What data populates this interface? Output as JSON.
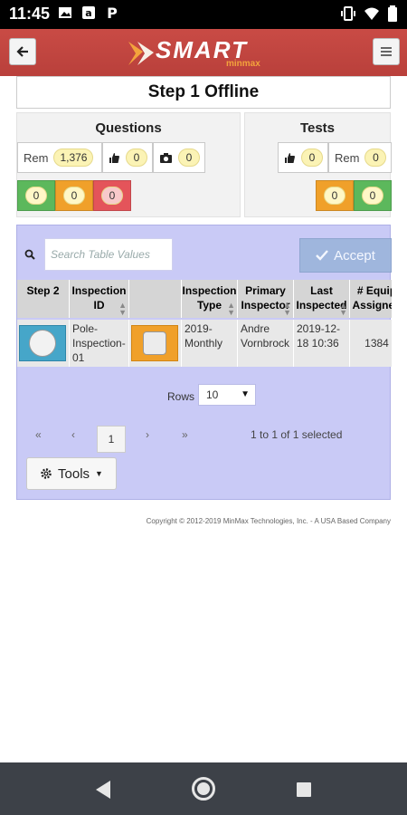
{
  "status_bar": {
    "time": "11:45",
    "icons": [
      "image-icon",
      "amazon-icon",
      "parking-icon",
      "vibrate-icon",
      "wifi-icon",
      "battery-icon"
    ]
  },
  "header": {
    "back_icon": "back-arrow-icon",
    "menu_icon": "hamburger-icon",
    "logo_word": "SMART",
    "logo_sub": "minmax"
  },
  "page_title": "Step 1 Offline",
  "questions": {
    "title": "Questions",
    "remaining_label": "Rem",
    "remaining_count": "1,376",
    "thumbs_count": "0",
    "camera_count": "0",
    "green_count": "0",
    "orange_count": "0",
    "red_count": "0"
  },
  "tests": {
    "title": "Tests",
    "thumbs_count": "0",
    "remaining_label": "Rem",
    "remaining_count": "0",
    "orange_count": "0",
    "green_count": "0"
  },
  "table": {
    "search_placeholder": "Search Table Values",
    "accept_label": "Accept",
    "columns": [
      "Step 2",
      "Inspection ID",
      "",
      "Inspection Type",
      "Primary Inspector",
      "Last Inspected",
      "# Equip Assigned"
    ],
    "row": {
      "inspection_id": "Pole-Inspection-01",
      "inspection_type": "2019-Monthly",
      "primary_inspector": "Andre Vornbrock",
      "last_inspected": "2019-12-18 10:36",
      "equip_assigned": "1384"
    },
    "rows_label": "Rows",
    "rows_value": "10",
    "pager": {
      "first": "«",
      "prev": "‹",
      "page": "1",
      "next": "›",
      "last": "»",
      "summary": "1 to 1 of 1 selected"
    },
    "tools_label": "Tools"
  },
  "footer": {
    "copyright": "Copyright © 2012-2019 MinMax Technologies, Inc. - A USA Based Company"
  },
  "colors": {
    "header_red": "#c0443f",
    "card_lavender": "#c9caf6",
    "green": "#5cb85c",
    "orange": "#f0a02a",
    "red": "#e4545a",
    "accept_blue": "#9fb6dd"
  }
}
